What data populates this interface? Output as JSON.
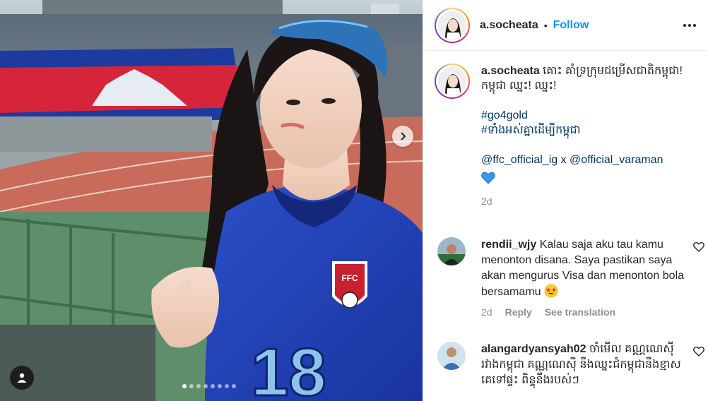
{
  "post": {
    "username": "a.socheata",
    "separator": "•",
    "follow_label": "Follow",
    "more_icon": "more-horizontal-icon",
    "carousel": {
      "slide_count": 8,
      "active_index": 0
    },
    "photo": {
      "jersey_number": "18",
      "crest_text": "FFC"
    }
  },
  "caption": {
    "username": "a.socheata",
    "text": "គោះ គាំទ្រក្រុមជម្រើសជាតិកម្ពុជា! កម្ពុជា ឈ្នះ! ឈ្នះ!",
    "hashtag_1": "#go4gold",
    "hashtag_2": "#ទាំងអស់គ្នាដើម្បីកម្ពុជា",
    "mention_1": "@ffc_official_ig",
    "mention_joiner": " x ",
    "mention_2": "@official_varaman",
    "heart_emoji": "blue-heart-icon",
    "time": "2d"
  },
  "comments": [
    {
      "username": "rendii_wjy",
      "text": "Kalau saja aku tau kamu menonton disana. Saya pastikan saya akan mengurus Visa dan menonton bola bersamamu",
      "emoji": "star-struck-emoji-icon",
      "time": "2d",
      "reply_label": "Reply",
      "translate_label": "See translation"
    },
    {
      "username": "alangardyansyah02",
      "text": "ចាំមើល គណ្ណណេស៊ី រវាងកម្ពុជា គណ្ណណេស៊ី នឹងឈ្នះជំកម្ពុជានឹងខ្មាសគេទៅផ្ទះ ពិន្ទុនឹងរបស់ៗ"
    }
  ],
  "colors": {
    "accent": "#0095f6",
    "link": "#00376b",
    "muted": "#8e8e8e",
    "text": "#262626",
    "heart_blue": "#3897f0",
    "jersey": "#1f3fb0"
  }
}
